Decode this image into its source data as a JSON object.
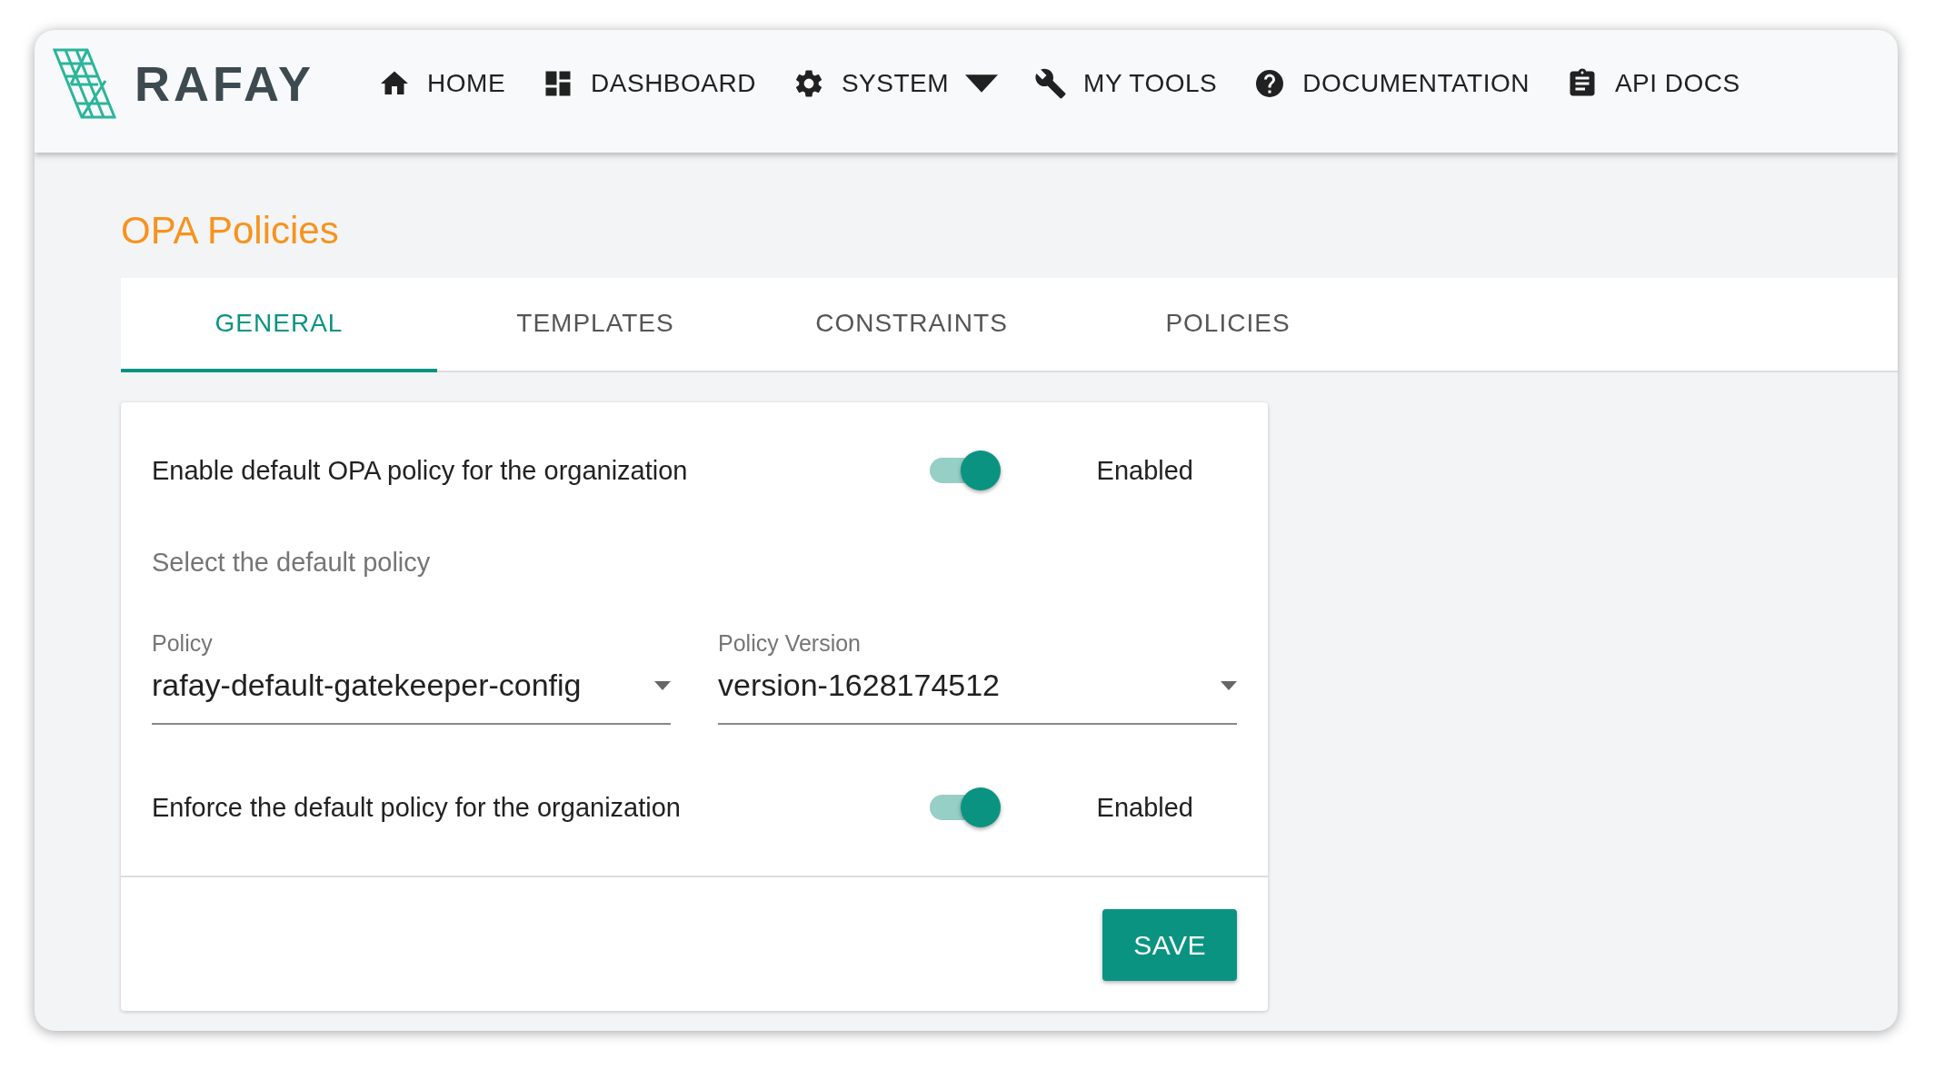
{
  "header": {
    "logo": "RAFAY",
    "nav": [
      {
        "label": "HOME",
        "dropdown": false
      },
      {
        "label": "DASHBOARD",
        "dropdown": false
      },
      {
        "label": "SYSTEM",
        "dropdown": true
      },
      {
        "label": "MY TOOLS",
        "dropdown": false
      },
      {
        "label": "DOCUMENTATION",
        "dropdown": false
      },
      {
        "label": "API DOCS",
        "dropdown": false
      }
    ]
  },
  "page_title": "OPA Policies",
  "tabs": [
    {
      "label": "GENERAL",
      "selected": true
    },
    {
      "label": "TEMPLATES",
      "selected": false
    },
    {
      "label": "CONSTRAINTS",
      "selected": false
    },
    {
      "label": "POLICIES",
      "selected": false
    }
  ],
  "form": {
    "enable_row": {
      "label": "Enable default OPA policy for the organization",
      "on": true,
      "status": "Enabled"
    },
    "section_label": "Select the default policy",
    "selects": [
      {
        "label": "Policy",
        "value": "rafay-default-gatekeeper-config"
      },
      {
        "label": "Policy Version",
        "value": "version-1628174512"
      }
    ],
    "enforce_row": {
      "label": "Enforce the default policy for the organization",
      "on": true,
      "status": "Enabled"
    },
    "save_button": "SAVE"
  }
}
